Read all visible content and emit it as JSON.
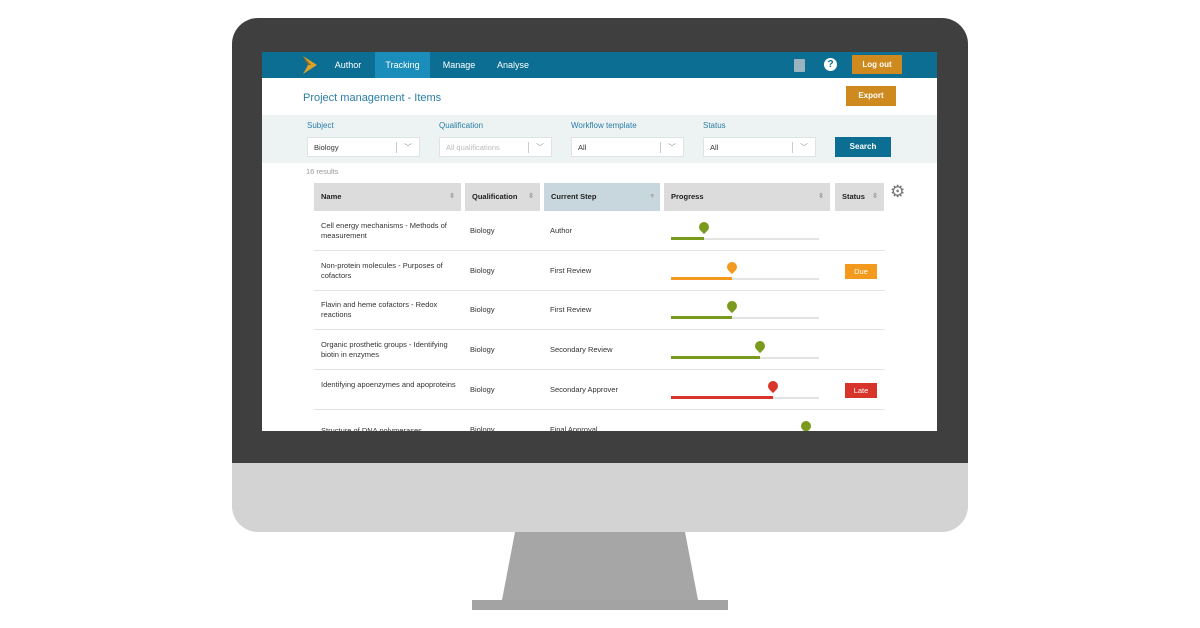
{
  "nav": {
    "tabs": [
      "Author",
      "Tracking",
      "Manage",
      "Analyse"
    ],
    "active": "Tracking",
    "logout": "Log out",
    "accent": "#0b6e92"
  },
  "page": {
    "title": "Project management - Items",
    "export": "Export"
  },
  "filters": {
    "subject": {
      "label": "Subject",
      "value": "Biology"
    },
    "qualification": {
      "label": "Qualification",
      "placeholder": "All qualifications"
    },
    "workflow": {
      "label": "Workflow template",
      "value": "All"
    },
    "status": {
      "label": "Status",
      "value": "All"
    },
    "search": "Search"
  },
  "results": "16 results",
  "table": {
    "headers": [
      "Name",
      "Qualification",
      "Current Step",
      "Progress",
      "Status"
    ],
    "rows": [
      {
        "name": "Cell energy mechanisms - Methods of measurement",
        "qualification": "Biology",
        "step": "Author",
        "progress": 0.22,
        "color": "#7a9a1e",
        "status": ""
      },
      {
        "name": "Non-protein molecules - Purposes of cofactors",
        "qualification": "Biology",
        "step": "First Review",
        "progress": 0.41,
        "color": "#f39a1e",
        "status": "Due"
      },
      {
        "name": "Flavin and heme cofactors - Redox reactions",
        "qualification": "Biology",
        "step": "First Review",
        "progress": 0.41,
        "color": "#7a9a1e",
        "status": ""
      },
      {
        "name": "Organic prosthetic groups - Identifying biotin in enzymes",
        "qualification": "Biology",
        "step": "Secondary Review",
        "progress": 0.6,
        "color": "#7a9a1e",
        "status": ""
      },
      {
        "name": "Identifying apoenzymes and apoproteins",
        "qualification": "Biology",
        "step": "Secondary Approver",
        "progress": 0.69,
        "color": "#d8352a",
        "status": "Late"
      },
      {
        "name": "Structure of DNA polymerases",
        "qualification": "Biology",
        "step": "Final Approval",
        "progress": 0.91,
        "color": "#7a9a1e",
        "status": ""
      }
    ]
  },
  "status_colors": {
    "Due": "#f39a1e",
    "Late": "#d8352a"
  }
}
